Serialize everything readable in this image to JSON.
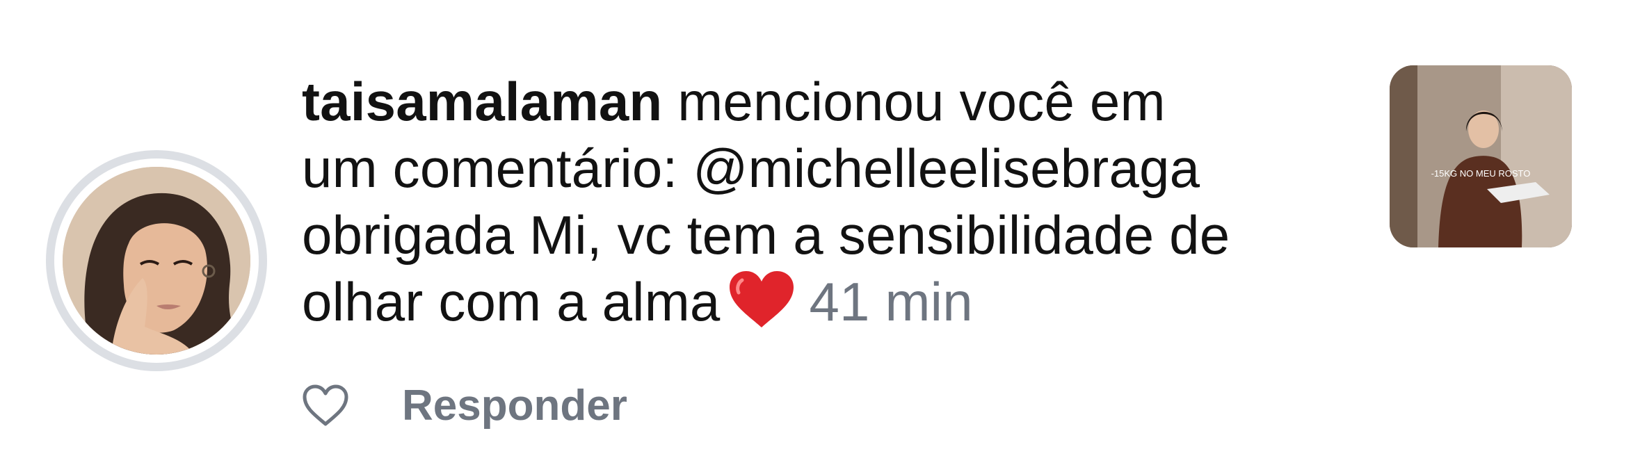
{
  "notification": {
    "username": "taisamalaman",
    "text_line1": " mencionou você em",
    "text_line2": "um comentário: @michelleelisebraga",
    "text_line3": "obrigada Mi, vc tem a sensibilidade de",
    "text_line4": "olhar com a alma",
    "emoji": "heart-emoji",
    "timestamp": "41 min",
    "thumbnail_caption": "-15KG NO MEU ROSTO"
  },
  "actions": {
    "like_icon": "heart-outline-icon",
    "reply_label": "Responder"
  },
  "colors": {
    "text": "#121212",
    "secondary_text": "#6e7580",
    "story_ring": "#dcdfe4",
    "heart_red": "#e0242b"
  }
}
